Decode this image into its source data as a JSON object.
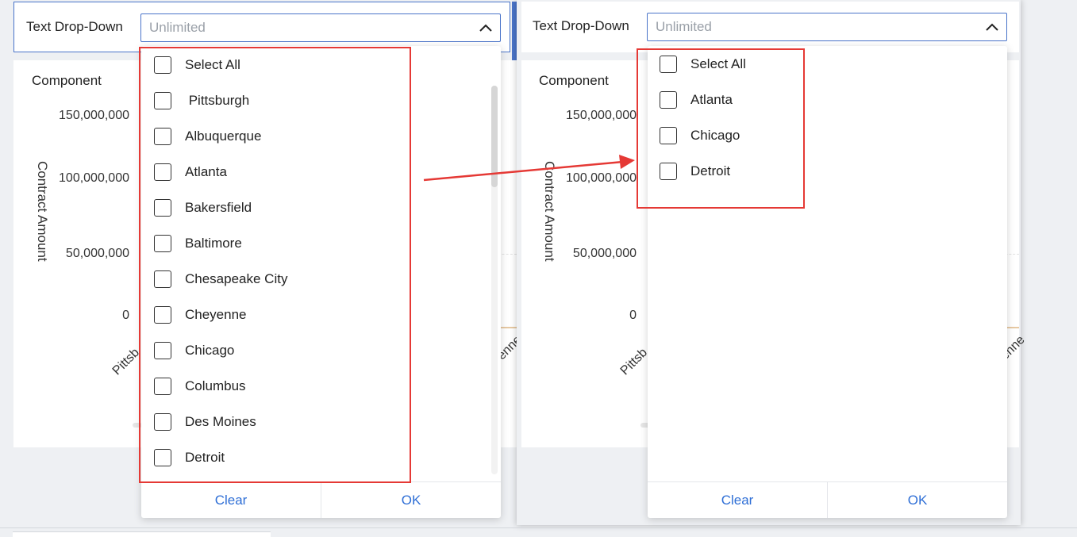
{
  "left_panel": {
    "filter_label": "Text Drop-Down",
    "dropdown_placeholder": "Unlimited",
    "chart": {
      "component_title": "Component",
      "y_axis_label": "Contract Amount",
      "y_ticks": [
        "150,000,000",
        "100,000,000",
        "50,000,000",
        "0"
      ],
      "x_ticks_visible": [
        "Pittsb",
        "enne"
      ]
    },
    "options": [
      {
        "label": "Select All",
        "checked": false
      },
      {
        "label": " Pittsburgh",
        "checked": false
      },
      {
        "label": "Albuquerque",
        "checked": false
      },
      {
        "label": "Atlanta",
        "checked": false
      },
      {
        "label": "Bakersfield",
        "checked": false
      },
      {
        "label": "Baltimore",
        "checked": false
      },
      {
        "label": "Chesapeake City",
        "checked": false
      },
      {
        "label": "Cheyenne",
        "checked": false
      },
      {
        "label": "Chicago",
        "checked": false
      },
      {
        "label": "Columbus",
        "checked": false
      },
      {
        "label": "Des Moines",
        "checked": false
      },
      {
        "label": "Detroit",
        "checked": false
      }
    ],
    "clear_label": "Clear",
    "ok_label": "OK"
  },
  "right_panel": {
    "filter_label": "Text Drop-Down",
    "dropdown_placeholder": "Unlimited",
    "chart": {
      "component_title": "Component",
      "y_axis_label": "Contract Amount",
      "y_ticks": [
        "150,000,000",
        "100,000,000",
        "50,000,000",
        "0"
      ],
      "x_ticks_visible": [
        "Pittsb",
        "enne"
      ]
    },
    "options": [
      {
        "label": "Select All",
        "checked": false
      },
      {
        "label": "Atlanta",
        "checked": false
      },
      {
        "label": "Chicago",
        "checked": false
      },
      {
        "label": "Detroit",
        "checked": false
      }
    ],
    "clear_label": "Clear",
    "ok_label": "OK"
  },
  "colors": {
    "accent_blue": "#2f6fd6",
    "input_border": "#4a74c9",
    "highlight_red": "#e53935"
  },
  "icons": {
    "dropdown_toggle": "chevron-up-icon",
    "annotation": "red-arrow"
  }
}
